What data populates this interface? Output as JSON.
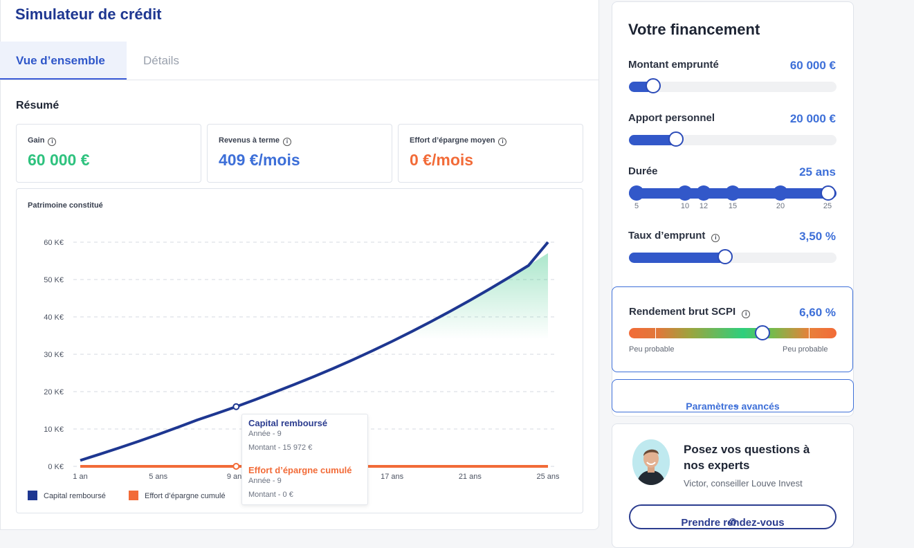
{
  "header": {
    "title": "Simulateur de crédit"
  },
  "tabs": [
    {
      "label": "Vue d’ensemble",
      "active": true
    },
    {
      "label": "Détails",
      "active": false
    }
  ],
  "resume": {
    "title": "Résumé",
    "cards": [
      {
        "label": "Gain",
        "value": "60 000 €",
        "color": "#2ec27e"
      },
      {
        "label": "Revenus à terme",
        "value": "409 €/mois",
        "color": "#3d6fd8"
      },
      {
        "label": "Effort d’épargne moyen",
        "value": "0 €/mois",
        "color": "#f26b38"
      }
    ]
  },
  "chart_data": {
    "type": "line",
    "title": "Patrimoine constitué",
    "x": [
      1,
      2,
      3,
      4,
      5,
      6,
      7,
      8,
      9,
      10,
      11,
      12,
      13,
      14,
      15,
      16,
      17,
      18,
      19,
      20,
      21,
      22,
      23,
      24,
      25
    ],
    "x_ticks": [
      "1 an",
      "5 ans",
      "9 ans",
      "13 ans",
      "17 ans",
      "21 ans",
      "25 ans"
    ],
    "y_ticks": [
      "0 K€",
      "10 K€",
      "20 K€",
      "30 K€",
      "40 K€",
      "50 K€",
      "60 K€"
    ],
    "ylim": [
      0,
      60000
    ],
    "grid": true,
    "series": [
      {
        "name": "Capital remboursé",
        "color": "#1e3791",
        "values": [
          1600,
          3250,
          4950,
          6720,
          8550,
          10450,
          12400,
          14160,
          15972,
          17900,
          19900,
          21950,
          24050,
          26250,
          28550,
          30950,
          33450,
          36050,
          38750,
          41550,
          44450,
          47450,
          50550,
          53750,
          57050
        ]
      },
      {
        "name": "Effort d’épargne cumulé",
        "color": "#f26b38",
        "values": [
          0,
          0,
          0,
          0,
          0,
          0,
          0,
          0,
          0,
          0,
          0,
          0,
          0,
          0,
          0,
          0,
          0,
          0,
          0,
          0,
          0,
          0,
          0,
          0,
          0
        ]
      }
    ],
    "legend": "bottom-left",
    "tooltip": {
      "items": [
        {
          "series": "Capital remboursé",
          "year": "Année - 9",
          "amount": "Montant - 15 972 €"
        },
        {
          "series": "Effort d’épargne cumulé",
          "year": "Année - 9",
          "amount": "Montant - 0 €"
        }
      ]
    }
  },
  "financement": {
    "title": "Votre financement",
    "sliders": [
      {
        "label": "Montant emprunté",
        "value": "60 000 €",
        "fraction": 0.12
      },
      {
        "label": "Apport personnel",
        "value": "20 000 €",
        "fraction": 0.23
      },
      {
        "label": "Durée",
        "value": "25 ans",
        "fraction": 1.0,
        "ticks": [
          "5",
          "10",
          "12",
          "15",
          "20",
          "25"
        ]
      },
      {
        "label": "Taux d’emprunt",
        "value": "3,50 %",
        "fraction": 0.47
      }
    ]
  },
  "scpi": {
    "label": "Rendement brut SCPI",
    "value": "6,60 %",
    "fraction": 0.645,
    "left_caption": "Peu probable",
    "right_caption": "Peu probable"
  },
  "advanced": {
    "label": "Paramètres avancés"
  },
  "expert": {
    "title": "Posez vos questions à nos experts",
    "subtitle": "Victor, conseiller Louve Invest",
    "button": "Prendre rendez-vous"
  }
}
